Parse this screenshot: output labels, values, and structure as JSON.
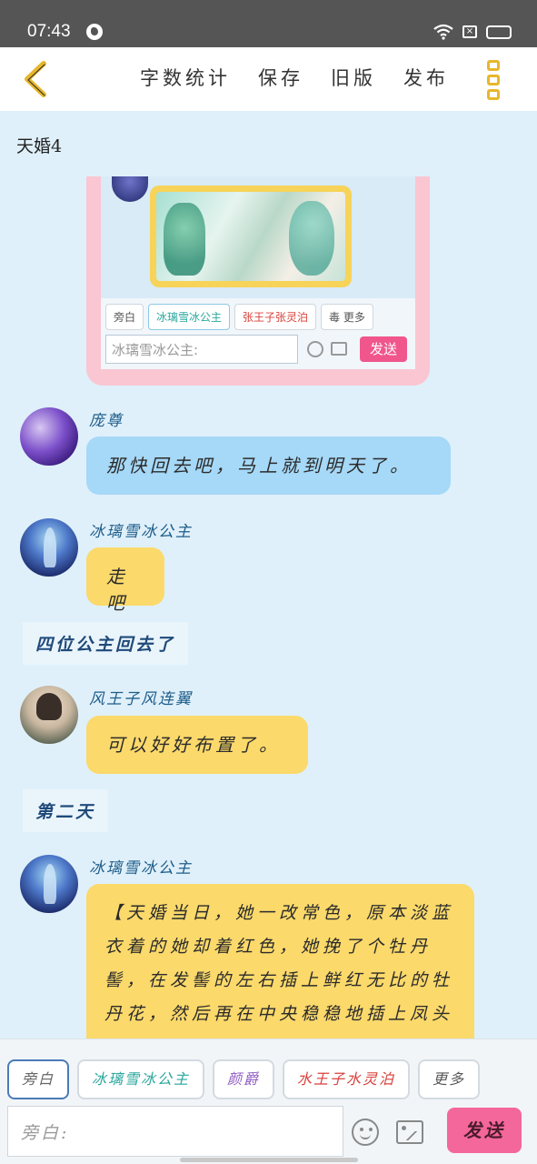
{
  "status_bar": {
    "time": "07:43"
  },
  "header": {
    "actions": [
      "字数统计",
      "保存",
      "旧版",
      "发布"
    ]
  },
  "chat": {
    "title": "天婚4",
    "embedded_screenshot": {
      "chips": [
        "旁白",
        "冰璃雪冰公主",
        "张王子张灵泊",
        "毒",
        "更多"
      ],
      "input_placeholder": "冰璃雪冰公主:",
      "send_label": "发送"
    },
    "messages": [
      {
        "sender": "庞尊",
        "text": "那快回去吧，马上就到明天了。",
        "bubble": "blue"
      },
      {
        "sender": "冰璃雪冰公主",
        "text": "走吧",
        "bubble": "yellow"
      },
      {
        "narration": "四位公主回去了"
      },
      {
        "sender": "风王子风连翼",
        "text": "可以好好布置了。",
        "bubble": "yellow"
      },
      {
        "narration": "第二天"
      },
      {
        "sender": "冰璃雪冰公主",
        "text": "【天婚当日，她一改常色，原本淡蓝衣着的她却着红色，她挽了个牡丹髻，在发髻的左右插上鲜红无比的牡丹花，然后再在中央稳稳地插上凤头步摇，尽显雍容华贵。金",
        "bubble": "yellow"
      }
    ]
  },
  "composer": {
    "chips": [
      "旁白",
      "冰璃雪冰公主",
      "颜爵",
      "水王子水灵泊",
      "更多"
    ],
    "input_placeholder": "旁白:",
    "send_label": "发送"
  }
}
